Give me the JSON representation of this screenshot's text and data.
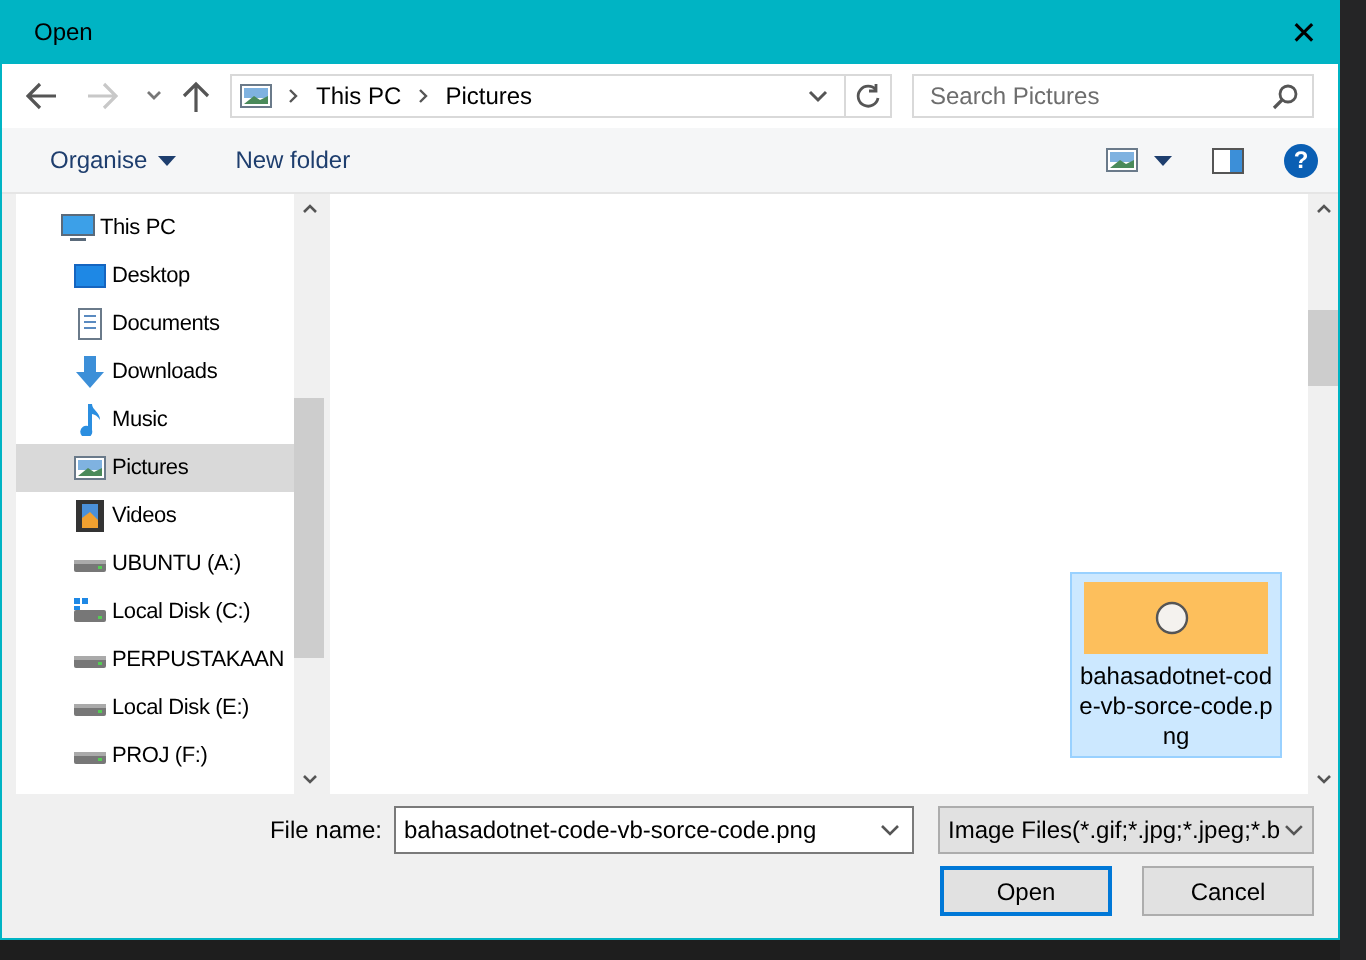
{
  "window": {
    "title": "Open",
    "close": "✕"
  },
  "nav": {
    "breadcrumb": [
      "This PC",
      "Pictures"
    ],
    "search": {
      "placeholder": "Search Pictures"
    }
  },
  "toolbar": {
    "organise": "Organise",
    "new_folder": "New folder",
    "help": "?"
  },
  "sidebar": {
    "items": [
      {
        "label": "This PC",
        "kind": "pc",
        "selected": false,
        "children": [
          {
            "label": "Desktop",
            "kind": "desktop",
            "selected": false
          },
          {
            "label": "Documents",
            "kind": "documents",
            "selected": false
          },
          {
            "label": "Downloads",
            "kind": "downloads",
            "selected": false
          },
          {
            "label": "Music",
            "kind": "music",
            "selected": false
          },
          {
            "label": "Pictures",
            "kind": "pictures",
            "selected": true
          },
          {
            "label": "Videos",
            "kind": "videos",
            "selected": false
          },
          {
            "label": "UBUNTU (A:)",
            "kind": "drive",
            "selected": false
          },
          {
            "label": "Local Disk (C:)",
            "kind": "system-drive",
            "selected": false
          },
          {
            "label": "PERPUSTAKAAN",
            "kind": "drive",
            "selected": false
          },
          {
            "label": "Local Disk (E:)",
            "kind": "drive",
            "selected": false
          },
          {
            "label": "PROJ (F:)",
            "kind": "drive",
            "selected": false
          }
        ]
      }
    ]
  },
  "files": [
    {
      "name": "bahasadotnet-code-vb-sorce-code.png",
      "selected": true
    }
  ],
  "footer": {
    "file_name_label": "File name:",
    "file_name": "bahasadotnet-code-vb-sorce-code.png",
    "file_type": "Image Files(*.gif;*.jpg;*.jpeg;*.b",
    "buttons": [
      {
        "label": "Open",
        "default": true
      },
      {
        "label": "Cancel",
        "default": false
      }
    ]
  }
}
